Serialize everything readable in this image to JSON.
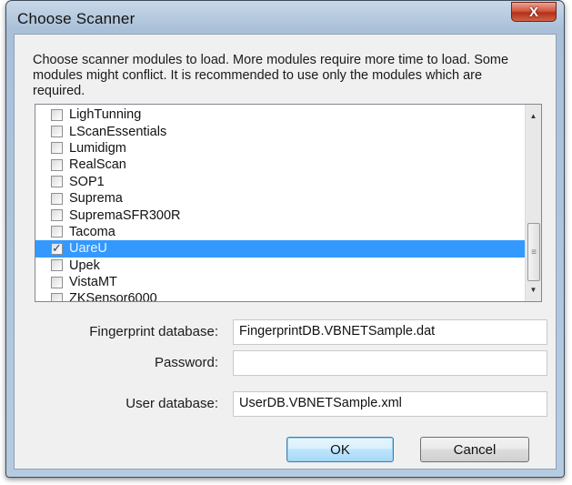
{
  "window": {
    "title": "Choose Scanner",
    "close_label": "X"
  },
  "instructions": "Choose scanner modules to load. More modules require more time to load. Some modules might conflict. It is recommended to use only the modules which are required.",
  "modules": [
    {
      "label": "LighTunning",
      "checked": false,
      "selected": false
    },
    {
      "label": "LScanEssentials",
      "checked": false,
      "selected": false
    },
    {
      "label": "Lumidigm",
      "checked": false,
      "selected": false
    },
    {
      "label": "RealScan",
      "checked": false,
      "selected": false
    },
    {
      "label": "SOP1",
      "checked": false,
      "selected": false
    },
    {
      "label": "Suprema",
      "checked": false,
      "selected": false
    },
    {
      "label": "SupremaSFR300R",
      "checked": false,
      "selected": false
    },
    {
      "label": "Tacoma",
      "checked": false,
      "selected": false
    },
    {
      "label": "UareU",
      "checked": true,
      "selected": true
    },
    {
      "label": "Upek",
      "checked": false,
      "selected": false
    },
    {
      "label": "VistaMT",
      "checked": false,
      "selected": false
    },
    {
      "label": "ZKSensor6000",
      "checked": false,
      "selected": false
    }
  ],
  "form": {
    "fingerprint_label": "Fingerprint database:",
    "fingerprint_value": "FingerprintDB.VBNETSample.dat",
    "password_label": "Password:",
    "password_value": "",
    "user_label": "User database:",
    "user_value": "UserDB.VBNETSample.xml"
  },
  "buttons": {
    "ok": "OK",
    "cancel": "Cancel"
  },
  "colors": {
    "selection": "#3399ff",
    "close_button": "#c7412a",
    "default_button_border": "#3c7fb1"
  }
}
